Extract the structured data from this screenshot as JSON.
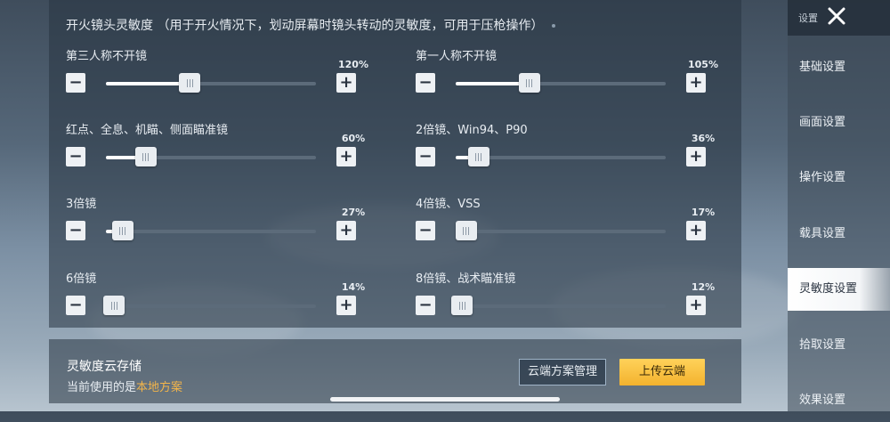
{
  "section_title": "开火镜头灵敏度 （用于开火情况下，划动屏幕时镜头转动的灵敏度，可用于压枪操作）",
  "step_minus_symbol": "−",
  "step_plus_symbol": "+",
  "sliders": [
    {
      "label": "第三人称不开镜",
      "value_text": "120%",
      "level": 0.4
    },
    {
      "label": "第一人称不开镜",
      "value_text": "105%",
      "level": 0.35
    },
    {
      "label": "红点、全息、机瞄、侧面瞄准镜",
      "value_text": "60%",
      "level": 0.19
    },
    {
      "label": "2倍镜、Win94、P90",
      "value_text": "36%",
      "level": 0.11
    },
    {
      "label": "3倍镜",
      "value_text": "27%",
      "level": 0.08
    },
    {
      "label": "4倍镜、VSS",
      "value_text": "17%",
      "level": 0.05
    },
    {
      "label": "6倍镜",
      "value_text": "14%",
      "level": 0.04
    },
    {
      "label": "8倍镜、战术瞄准镜",
      "value_text": "12%",
      "level": 0.03
    }
  ],
  "cloud": {
    "title": "灵敏度云存储",
    "current_prefix": "当前使用的是",
    "current_scheme": "本地方案",
    "manage_label": "云端方案管理",
    "upload_label": "上传云端"
  },
  "sidebar": {
    "header": "设置",
    "items": [
      {
        "label": "基础设置",
        "active": false
      },
      {
        "label": "画面设置",
        "active": false
      },
      {
        "label": "操作设置",
        "active": false
      },
      {
        "label": "载具设置",
        "active": false
      },
      {
        "label": "灵敏度设置",
        "active": true
      },
      {
        "label": "拾取设置",
        "active": false
      },
      {
        "label": "效果设置",
        "active": false
      }
    ]
  },
  "colors": {
    "accent_orange": "#f3b54a",
    "upload_button": "#f3b22e",
    "panel": "#283442"
  },
  "icons": {
    "close": "close-icon"
  }
}
